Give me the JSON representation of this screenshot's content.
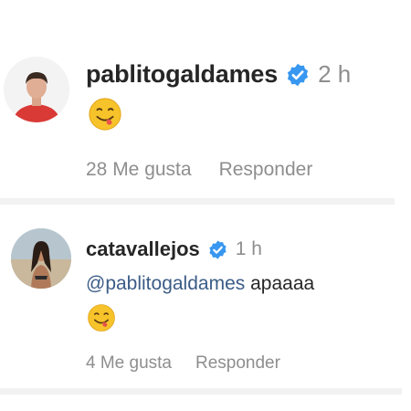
{
  "comments": [
    {
      "username": "pablitogaldames",
      "time": "2 h",
      "text": "",
      "emoji": "smiling-face-with-tongue-emoji",
      "likes": "28 Me gusta",
      "reply": "Responder",
      "verified": true
    },
    {
      "username": "catavallejos",
      "time": "1 h",
      "mention": "@pablitogaldames",
      "text": "apaaaa",
      "emoji": "smiling-face-with-tongue-emoji",
      "likes": "4 Me gusta",
      "reply": "Responder",
      "verified": true
    }
  ],
  "colors": {
    "username": "#262626",
    "secondary_text": "#8e8e8e",
    "mention": "#3b5c86",
    "verified_badge": "#3897f0",
    "emoji": "#f7c32a",
    "divider": "#f2f2f2"
  }
}
